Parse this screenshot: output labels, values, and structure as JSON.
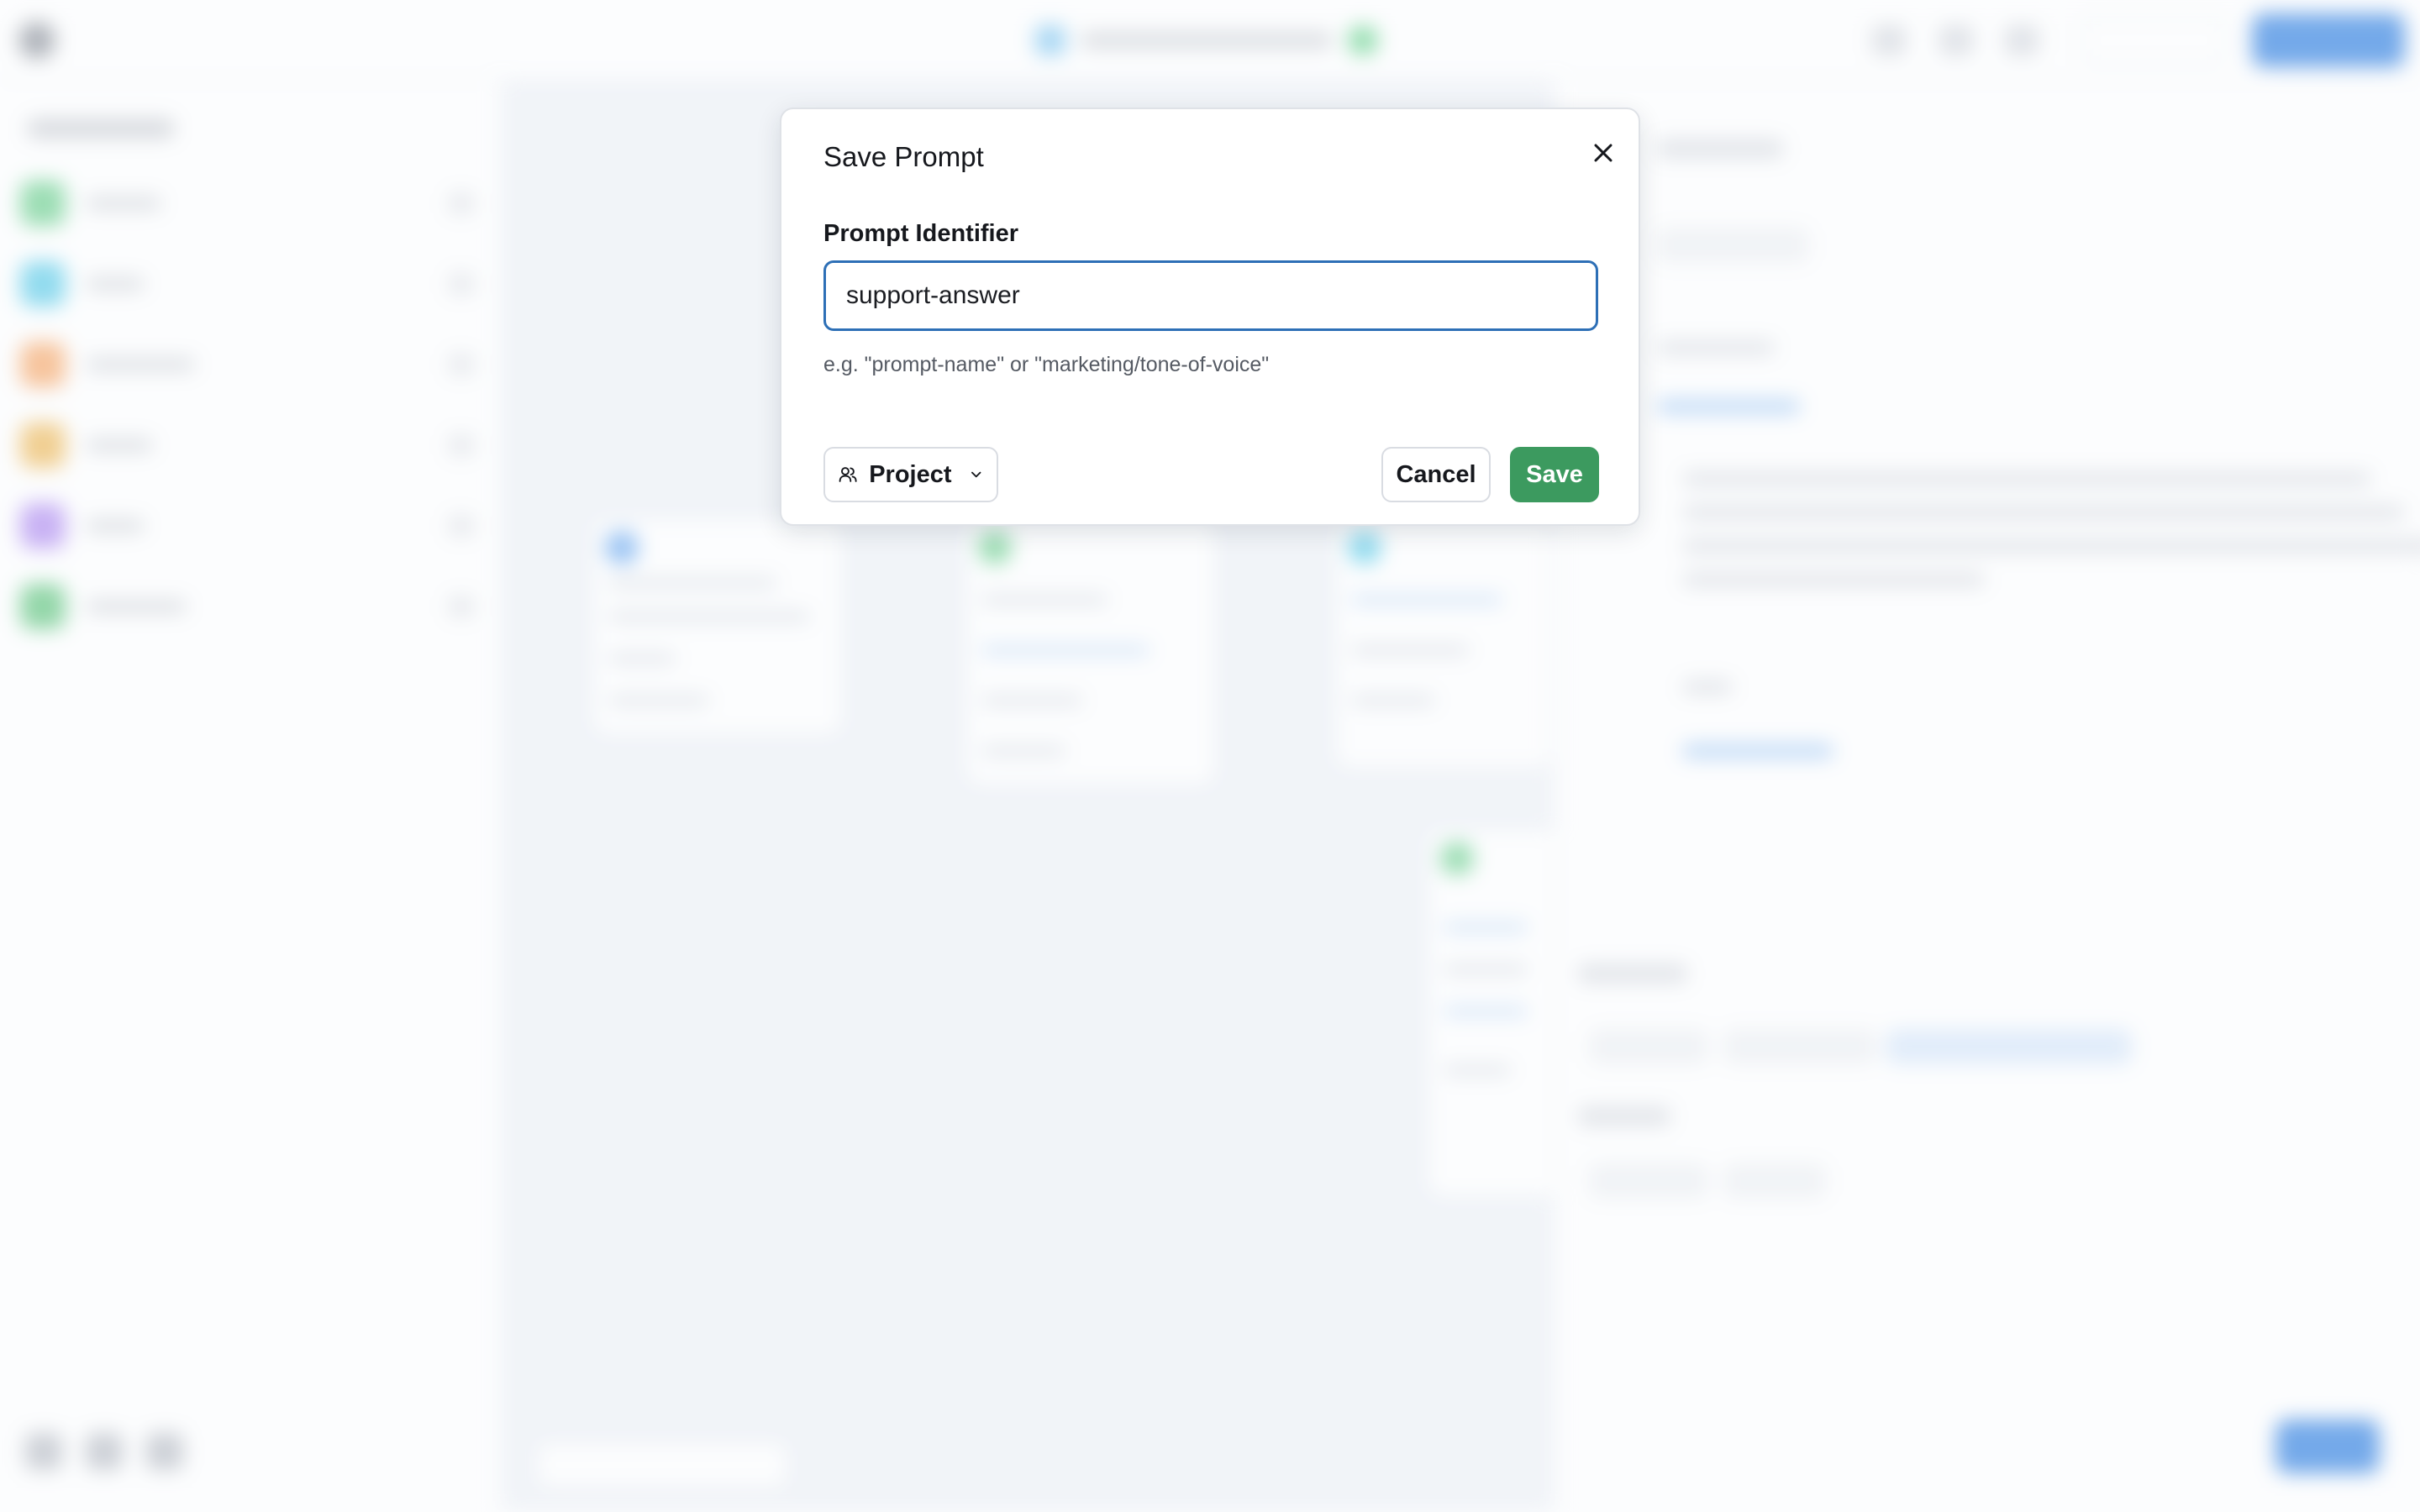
{
  "dialog": {
    "title": "Save Prompt",
    "field_label": "Prompt Identifier",
    "input_value": "support-answer",
    "hint": "e.g. \"prompt-name\" or \"marketing/tone-of-voice\"",
    "scope_label": "Project",
    "cancel_label": "Cancel",
    "save_label": "Save"
  },
  "icons": {
    "close": "close-icon",
    "scope": "users-icon",
    "dropdown": "chevron-down-icon"
  },
  "colors": {
    "save_button": "#3c9a5f",
    "input_focus_border": "#2d6fb6",
    "primary_blue": "#2f7fe0"
  }
}
